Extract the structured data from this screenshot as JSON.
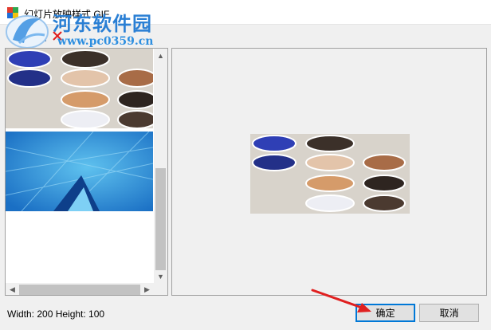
{
  "window": {
    "title": "幻灯片放映样式.GIF",
    "icon": "gif-file-icon"
  },
  "watermark": {
    "site_name": "河东软件园",
    "url": "www.pc0359.cn"
  },
  "toolbar": {
    "items": [
      {
        "name": "image-icon"
      },
      {
        "name": "close-icon"
      }
    ]
  },
  "status": {
    "text": "Width: 200  Height: 100"
  },
  "buttons": {
    "ok": "确定",
    "cancel": "取消"
  },
  "colors": {
    "window_bg": "#f0f0f0",
    "ok_border": "#0078d7",
    "annotation_arrow": "#e02020",
    "watermark_text": "#2a7fd4"
  }
}
